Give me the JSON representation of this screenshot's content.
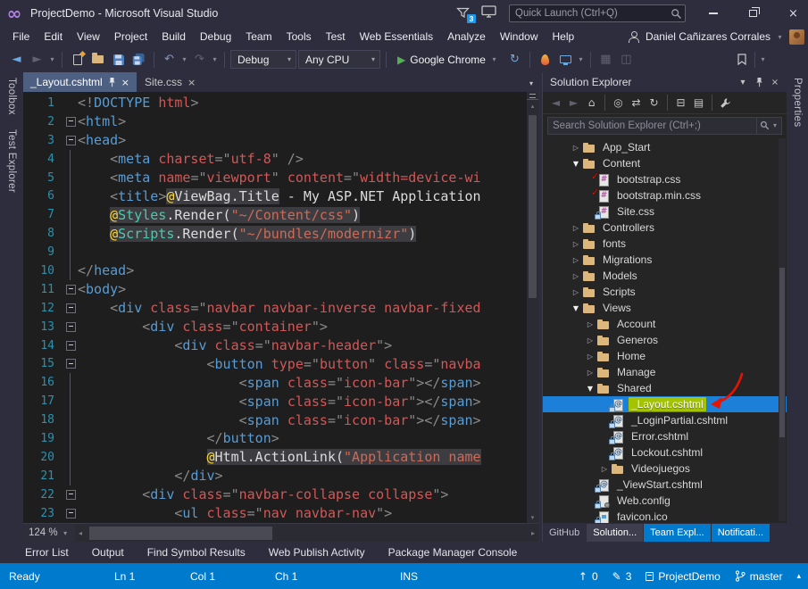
{
  "colors": {
    "chrome": "#2D2D3E",
    "editor_background": "#1E1E1E",
    "panel_background": "#252526",
    "status_bar_blue": "#007ACC",
    "selection_blue": "#1C80D9",
    "active_tab_unfocused": "#4D6082",
    "line_number": "#2B91AF",
    "tag_blue": "#569CD6",
    "attribute_red": "#D05858",
    "string_red": "#CE6A56",
    "razor_yellow": "#FDD835",
    "type_teal": "#4EC9B0",
    "folder_yellow": "#DCB67A",
    "highlight_green": "#A4C400",
    "annotation_red": "#E51400"
  },
  "icons": {
    "infinity_logo": "∞",
    "close": "×",
    "caret_down": "▾",
    "caret_up": "▴",
    "nav_back": "◄",
    "nav_forward": "►",
    "undo": "↶",
    "redo": "↷",
    "run_play": "▶",
    "refresh": "↻",
    "home": "⌂",
    "scope": "◎",
    "sync": "⇄",
    "collapse_all": "⊟",
    "show_all_files": "▤",
    "grid1": "▦",
    "grid2": "◫",
    "scroll_left": "◂",
    "scroll_right": "▸",
    "expander_open": "▼",
    "expander_closed": "▷",
    "check": "✓",
    "pencil": "✎",
    "up_arrow": "↑",
    "at_sign": "@",
    "hash": "#"
  },
  "titlebar": {
    "title": "ProjectDemo - Microsoft Visual Studio",
    "notification_count": "3",
    "quick_launch_placeholder": "Quick Launch (Ctrl+Q)"
  },
  "menubar": {
    "items": [
      "File",
      "Edit",
      "View",
      "Project",
      "Build",
      "Debug",
      "Team",
      "Tools",
      "Test",
      "Web Essentials",
      "Analyze",
      "Window",
      "Help"
    ],
    "user_name": "Daniel Cañizares Corrales"
  },
  "toolbar": {
    "configuration": "Debug",
    "platform": "Any CPU",
    "run_target": "Google Chrome"
  },
  "left_strip": {
    "tabs": [
      "Toolbox",
      "Test Explorer"
    ]
  },
  "right_strip": {
    "tabs": [
      "Properties"
    ]
  },
  "editor": {
    "tabs": [
      {
        "label": "_Layout.cshtml",
        "active": true
      },
      {
        "label": "Site.css",
        "active": false
      }
    ],
    "zoom": "124 %",
    "lines": [
      {
        "n": "1",
        "f": "",
        "s": [
          [
            "p",
            "<!"
          ],
          [
            "t",
            "DOCTYPE"
          ],
          [
            "w",
            " "
          ],
          [
            "a",
            "html"
          ],
          [
            "p",
            ">"
          ]
        ]
      },
      {
        "n": "2",
        "f": "box",
        "s": [
          [
            "p",
            "<"
          ],
          [
            "t",
            "html"
          ],
          [
            "p",
            ">"
          ]
        ]
      },
      {
        "n": "3",
        "f": "box",
        "s": [
          [
            "p",
            "<"
          ],
          [
            "t",
            "head"
          ],
          [
            "p",
            ">"
          ]
        ]
      },
      {
        "n": "4",
        "f": "bar",
        "s": [
          [
            "w",
            "    "
          ],
          [
            "p",
            "<"
          ],
          [
            "t",
            "meta"
          ],
          [
            "w",
            " "
          ],
          [
            "a",
            "charset"
          ],
          [
            "p",
            "=\""
          ],
          [
            "v",
            "utf-8"
          ],
          [
            "p",
            "\" />"
          ]
        ]
      },
      {
        "n": "5",
        "f": "bar",
        "s": [
          [
            "w",
            "    "
          ],
          [
            "p",
            "<"
          ],
          [
            "t",
            "meta"
          ],
          [
            "w",
            " "
          ],
          [
            "a",
            "name"
          ],
          [
            "p",
            "=\""
          ],
          [
            "v",
            "viewport"
          ],
          [
            "p",
            "\""
          ],
          [
            "w",
            " "
          ],
          [
            "a",
            "content"
          ],
          [
            "p",
            "=\""
          ],
          [
            "v",
            "width=device-wi"
          ]
        ]
      },
      {
        "n": "6",
        "f": "bar",
        "s": [
          [
            "w",
            "    "
          ],
          [
            "p",
            "<"
          ],
          [
            "t",
            "title"
          ],
          [
            "p",
            ">"
          ],
          [
            "r z",
            "@"
          ],
          [
            "id z",
            "ViewBag.Title"
          ],
          [
            "tx",
            " - My ASP.NET Application"
          ]
        ]
      },
      {
        "n": "7",
        "f": "bar",
        "s": [
          [
            "w",
            "    "
          ],
          [
            "r z",
            "@"
          ],
          [
            "ty z",
            "Styles"
          ],
          [
            "id z",
            ".Render("
          ],
          [
            "s z",
            "\"~/Content/css\""
          ],
          [
            "id z",
            ")"
          ]
        ]
      },
      {
        "n": "8",
        "f": "bar",
        "s": [
          [
            "w",
            "    "
          ],
          [
            "r z",
            "@"
          ],
          [
            "ty z",
            "Scripts"
          ],
          [
            "id z",
            ".Render("
          ],
          [
            "s z",
            "\"~/bundles/modernizr\""
          ],
          [
            "id z",
            ")"
          ]
        ]
      },
      {
        "n": "9",
        "f": "bar",
        "s": []
      },
      {
        "n": "10",
        "f": "bar",
        "s": [
          [
            "p",
            "</"
          ],
          [
            "t",
            "head"
          ],
          [
            "p",
            ">"
          ]
        ]
      },
      {
        "n": "11",
        "f": "box",
        "s": [
          [
            "p",
            "<"
          ],
          [
            "t",
            "body"
          ],
          [
            "p",
            ">"
          ]
        ]
      },
      {
        "n": "12",
        "f": "box",
        "s": [
          [
            "w",
            "    "
          ],
          [
            "p",
            "<"
          ],
          [
            "t",
            "div"
          ],
          [
            "w",
            " "
          ],
          [
            "a",
            "class"
          ],
          [
            "p",
            "=\""
          ],
          [
            "v",
            "navbar navbar-inverse navbar-fixed"
          ]
        ]
      },
      {
        "n": "13",
        "f": "box",
        "s": [
          [
            "w",
            "        "
          ],
          [
            "p",
            "<"
          ],
          [
            "t",
            "div"
          ],
          [
            "w",
            " "
          ],
          [
            "a",
            "class"
          ],
          [
            "p",
            "=\""
          ],
          [
            "v",
            "container"
          ],
          [
            "p",
            "\">"
          ]
        ]
      },
      {
        "n": "14",
        "f": "box",
        "s": [
          [
            "w",
            "            "
          ],
          [
            "p",
            "<"
          ],
          [
            "t",
            "div"
          ],
          [
            "w",
            " "
          ],
          [
            "a",
            "class"
          ],
          [
            "p",
            "=\""
          ],
          [
            "v",
            "navbar-header"
          ],
          [
            "p",
            "\">"
          ]
        ]
      },
      {
        "n": "15",
        "f": "box",
        "s": [
          [
            "w",
            "                "
          ],
          [
            "p",
            "<"
          ],
          [
            "t",
            "button"
          ],
          [
            "w",
            " "
          ],
          [
            "a",
            "type"
          ],
          [
            "p",
            "=\""
          ],
          [
            "v",
            "button"
          ],
          [
            "p",
            "\""
          ],
          [
            "w",
            " "
          ],
          [
            "a",
            "class"
          ],
          [
            "p",
            "=\""
          ],
          [
            "v",
            "navba"
          ]
        ]
      },
      {
        "n": "16",
        "f": "bar",
        "s": [
          [
            "w",
            "                    "
          ],
          [
            "p",
            "<"
          ],
          [
            "t",
            "span"
          ],
          [
            "w",
            " "
          ],
          [
            "a",
            "class"
          ],
          [
            "p",
            "=\""
          ],
          [
            "v",
            "icon-bar"
          ],
          [
            "p",
            "\"></"
          ],
          [
            "t",
            "span"
          ],
          [
            "p",
            ">"
          ]
        ]
      },
      {
        "n": "17",
        "f": "bar",
        "s": [
          [
            "w",
            "                    "
          ],
          [
            "p",
            "<"
          ],
          [
            "t",
            "span"
          ],
          [
            "w",
            " "
          ],
          [
            "a",
            "class"
          ],
          [
            "p",
            "=\""
          ],
          [
            "v",
            "icon-bar"
          ],
          [
            "p",
            "\"></"
          ],
          [
            "t",
            "span"
          ],
          [
            "p",
            ">"
          ]
        ]
      },
      {
        "n": "18",
        "f": "bar",
        "s": [
          [
            "w",
            "                    "
          ],
          [
            "p",
            "<"
          ],
          [
            "t",
            "span"
          ],
          [
            "w",
            " "
          ],
          [
            "a",
            "class"
          ],
          [
            "p",
            "=\""
          ],
          [
            "v",
            "icon-bar"
          ],
          [
            "p",
            "\"></"
          ],
          [
            "t",
            "span"
          ],
          [
            "p",
            ">"
          ]
        ]
      },
      {
        "n": "19",
        "f": "bar",
        "s": [
          [
            "w",
            "                "
          ],
          [
            "p",
            "</"
          ],
          [
            "t",
            "button"
          ],
          [
            "p",
            ">"
          ]
        ]
      },
      {
        "n": "20",
        "f": "bar",
        "s": [
          [
            "w",
            "                "
          ],
          [
            "r z",
            "@"
          ],
          [
            "id z",
            "Html.ActionLink("
          ],
          [
            "s z",
            "\"Application name"
          ]
        ]
      },
      {
        "n": "21",
        "f": "bar",
        "s": [
          [
            "w",
            "            "
          ],
          [
            "p",
            "</"
          ],
          [
            "t",
            "div"
          ],
          [
            "p",
            ">"
          ]
        ]
      },
      {
        "n": "22",
        "f": "box",
        "s": [
          [
            "w",
            "        "
          ],
          [
            "p",
            "<"
          ],
          [
            "t",
            "div"
          ],
          [
            "w",
            " "
          ],
          [
            "a",
            "class"
          ],
          [
            "p",
            "=\""
          ],
          [
            "v",
            "navbar-collapse collapse"
          ],
          [
            "p",
            "\">"
          ]
        ]
      },
      {
        "n": "23",
        "f": "box",
        "s": [
          [
            "w",
            "            "
          ],
          [
            "p",
            "<"
          ],
          [
            "t",
            "ul"
          ],
          [
            "w",
            " "
          ],
          [
            "a",
            "class"
          ],
          [
            "p",
            "=\""
          ],
          [
            "v",
            "nav navbar-nav"
          ],
          [
            "p",
            "\">"
          ]
        ]
      }
    ]
  },
  "solution_explorer": {
    "title": "Solution Explorer",
    "search_placeholder": "Search Solution Explorer (Ctrl+;)",
    "tree": [
      {
        "d": 1,
        "e": "c",
        "i": "folder",
        "l": "App_Start"
      },
      {
        "d": 1,
        "e": "o",
        "i": "folder",
        "l": "Content"
      },
      {
        "d": 2,
        "e": "",
        "i": "css",
        "chk": true,
        "l": "bootstrap.css"
      },
      {
        "d": 2,
        "e": "",
        "i": "css",
        "chk": true,
        "l": "bootstrap.min.css"
      },
      {
        "d": 2,
        "e": "",
        "i": "css",
        "lock": true,
        "l": "Site.css"
      },
      {
        "d": 1,
        "e": "c",
        "i": "folder",
        "l": "Controllers"
      },
      {
        "d": 1,
        "e": "c",
        "i": "folder",
        "l": "fonts"
      },
      {
        "d": 1,
        "e": "c",
        "i": "folder",
        "l": "Migrations"
      },
      {
        "d": 1,
        "e": "c",
        "i": "folder",
        "l": "Models"
      },
      {
        "d": 1,
        "e": "c",
        "i": "folder",
        "l": "Scripts"
      },
      {
        "d": 1,
        "e": "o",
        "i": "folder",
        "l": "Views"
      },
      {
        "d": 2,
        "e": "c",
        "i": "folder",
        "l": "Account"
      },
      {
        "d": 2,
        "e": "c",
        "i": "folder",
        "l": "Generos"
      },
      {
        "d": 2,
        "e": "c",
        "i": "folder",
        "l": "Home"
      },
      {
        "d": 2,
        "e": "c",
        "i": "folder",
        "l": "Manage"
      },
      {
        "d": 2,
        "e": "o",
        "i": "folder",
        "l": "Shared"
      },
      {
        "d": 3,
        "e": "",
        "i": "razor",
        "lock": true,
        "l": "_Layout.cshtml",
        "sel": true,
        "hl": true
      },
      {
        "d": 3,
        "e": "",
        "i": "razor",
        "lock": true,
        "l": "_LoginPartial.cshtml"
      },
      {
        "d": 3,
        "e": "",
        "i": "razor",
        "lock": true,
        "l": "Error.cshtml"
      },
      {
        "d": 3,
        "e": "",
        "i": "razor",
        "lock": true,
        "l": "Lockout.cshtml"
      },
      {
        "d": 3,
        "e": "c",
        "i": "folder",
        "l": "Videojuegos"
      },
      {
        "d": 2,
        "e": "",
        "i": "razor",
        "lock": true,
        "l": "_ViewStart.cshtml"
      },
      {
        "d": 2,
        "e": "",
        "i": "config",
        "lock": true,
        "l": "Web.config"
      },
      {
        "d": 2,
        "e": "",
        "i": "ico",
        "lock": true,
        "l": "favicon.ico"
      }
    ],
    "bottom_tabs": [
      {
        "l": "GitHub",
        "style": ""
      },
      {
        "l": "Solution...",
        "style": "active"
      },
      {
        "l": "Team Expl...",
        "style": "accent"
      },
      {
        "l": "Notificati...",
        "style": "accent"
      }
    ]
  },
  "bottom_panel": {
    "tabs": [
      "Error List",
      "Output",
      "Find Symbol Results",
      "Web Publish Activity",
      "Package Manager Console"
    ]
  },
  "statusbar": {
    "mode": "Ready",
    "line": "Ln 1",
    "column": "Col 1",
    "character": "Ch 1",
    "insert_mode": "INS",
    "unpublished_commits": "0",
    "uncommitted_changes": "3",
    "repository": "ProjectDemo",
    "branch": "master"
  }
}
